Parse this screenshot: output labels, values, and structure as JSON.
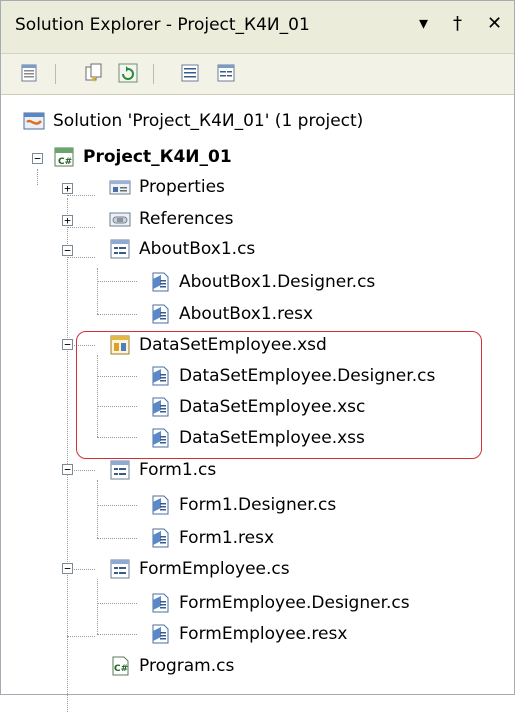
{
  "title": "Solution Explorer - Project_К4И_01",
  "title_controls": {
    "dropdown": "▾",
    "pin": "†",
    "close": "✕"
  },
  "toolbar": {
    "buttons": [
      {
        "name": "properties-button",
        "icon": "properties-icon"
      },
      {
        "name": "show-all-files-button",
        "icon": "show-all-files-icon"
      },
      {
        "name": "refresh-button",
        "icon": "refresh-icon"
      },
      {
        "name": "view-code-button",
        "icon": "view-code-icon"
      },
      {
        "name": "view-designer-button",
        "icon": "view-designer-icon"
      }
    ]
  },
  "tree": {
    "solution": "Solution 'Project_К4И_01' (1 project)",
    "project": "Project_К4И_01",
    "items": {
      "properties": "Properties",
      "references": "References",
      "aboutbox": "AboutBox1.cs",
      "aboutbox_designer": "AboutBox1.Designer.cs",
      "aboutbox_resx": "AboutBox1.resx",
      "dataset": "DataSetEmployee.xsd",
      "dataset_designer": "DataSetEmployee.Designer.cs",
      "dataset_xsc": "DataSetEmployee.xsc",
      "dataset_xss": "DataSetEmployee.xss",
      "form1": "Form1.cs",
      "form1_designer": "Form1.Designer.cs",
      "form1_resx": "Form1.resx",
      "formemployee": "FormEmployee.cs",
      "formemployee_designer": "FormEmployee.Designer.cs",
      "formemployee_resx": "FormEmployee.resx",
      "program": "Program.cs"
    },
    "expanders": {
      "plus": "+",
      "minus": "−"
    }
  },
  "colors": {
    "titlebar": "#ececdb",
    "toolbar": "#f3f2e7",
    "highlight_border": "#d32f3b"
  }
}
